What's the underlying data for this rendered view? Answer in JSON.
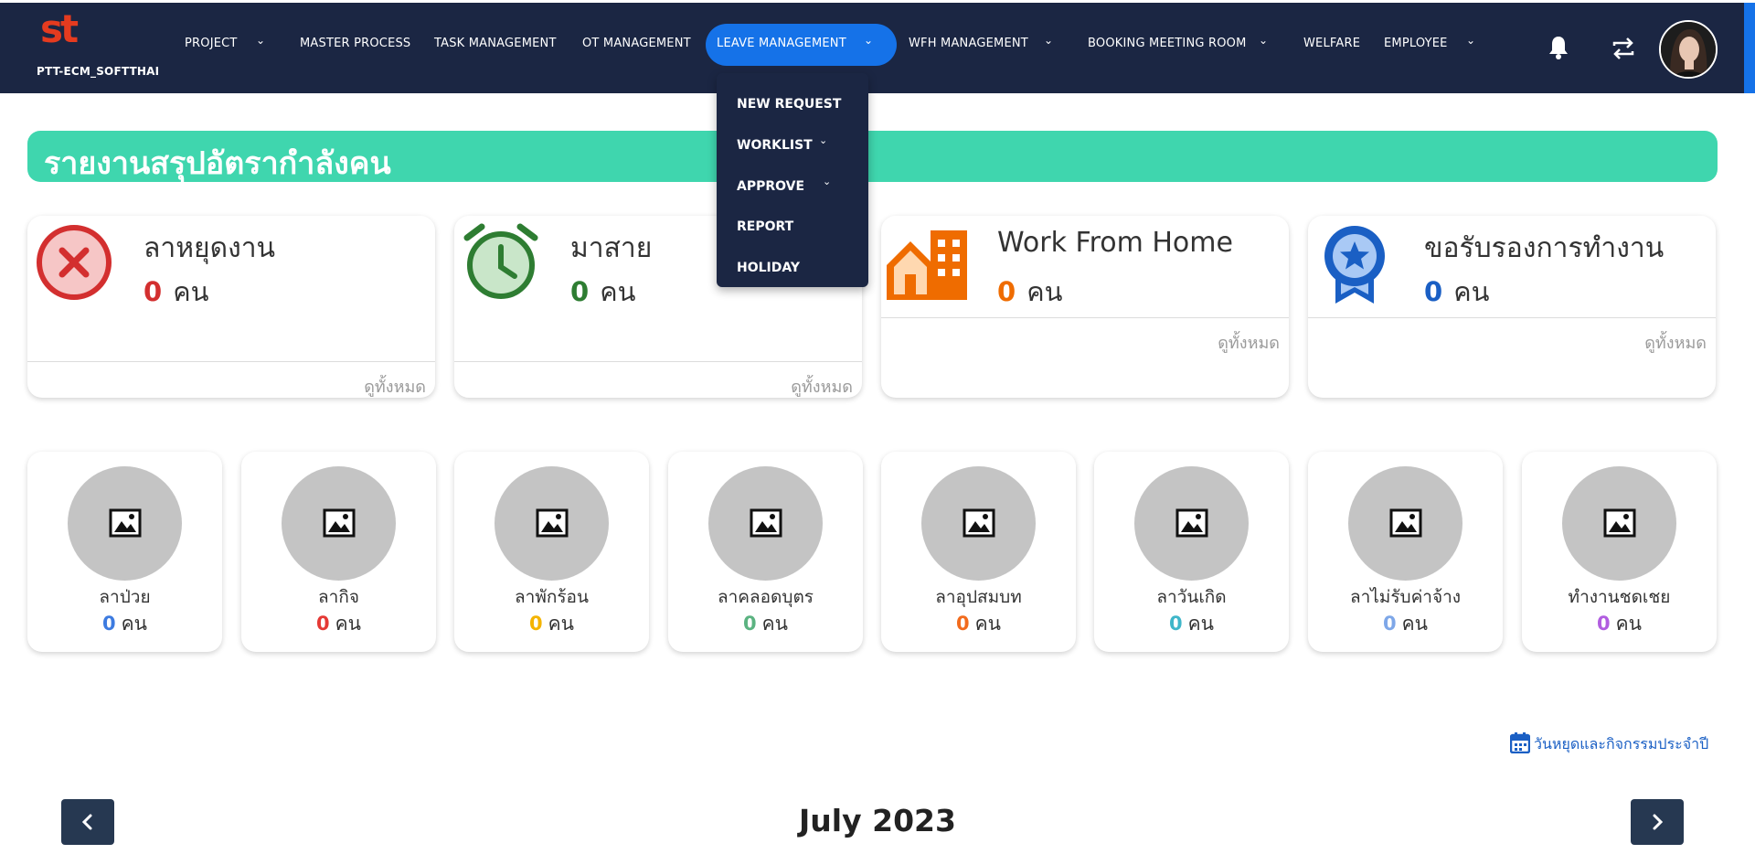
{
  "app": {
    "logo_text": "st",
    "org_name": "PTT-ECM_SOFTTHAI"
  },
  "nav": [
    {
      "label": "PROJECT",
      "dropdown": true
    },
    {
      "label": "MASTER PROCESS",
      "dropdown": false
    },
    {
      "label": "TASK MANAGEMENT",
      "dropdown": false
    },
    {
      "label": "OT MANAGEMENT",
      "dropdown": false
    },
    {
      "label": "LEAVE MANAGEMENT",
      "dropdown": true,
      "active": true
    },
    {
      "label": "WFH MANAGEMENT",
      "dropdown": true
    },
    {
      "label": "BOOKING MEETING ROOM",
      "dropdown": true
    },
    {
      "label": "WELFARE",
      "dropdown": false
    },
    {
      "label": "EMPLOYEE",
      "dropdown": true
    }
  ],
  "top_icons": [
    "bell-icon",
    "swap-icon"
  ],
  "dropdown": [
    {
      "label": "NEW REQUEST",
      "has_submenu": false
    },
    {
      "label": "WORKLIST",
      "has_submenu": true
    },
    {
      "label": "APPROVE",
      "has_submenu": true
    },
    {
      "label": "REPORT",
      "has_submenu": false
    },
    {
      "label": "HOLIDAY",
      "has_submenu": false
    }
  ],
  "banner": {
    "title": "รายงานสรุปอัตรากำลังคน",
    "color": "#3fd6ae"
  },
  "summary_cards": [
    {
      "label": "ลาหยุดงาน",
      "count": "0",
      "unit": "คน",
      "link": "ดูทั้งหมด",
      "icon": "x-circle-icon",
      "color": "#d32f2f"
    },
    {
      "label": "มาสาย",
      "count": "0",
      "unit": "คน",
      "link": "ดูทั้งหมด",
      "icon": "alarm-clock-icon",
      "color": "#2e7d32"
    },
    {
      "label": "Work From Home",
      "count": "0",
      "unit": "คน",
      "link": "ดูทั้งหมด",
      "icon": "building-icon",
      "color": "#ef6c00"
    },
    {
      "label": "ขอรับรองการทำงาน",
      "count": "0",
      "unit": "คน",
      "link": "ดูทั้งหมด",
      "icon": "award-ribbon-icon",
      "color": "#1a5fc4"
    }
  ],
  "leave_types": [
    {
      "label": "ลาป่วย",
      "count": "0",
      "unit": "คน",
      "color": "#3d7be0"
    },
    {
      "label": "ลากิจ",
      "count": "0",
      "unit": "คน",
      "color": "#e53935"
    },
    {
      "label": "ลาพักร้อน",
      "count": "0",
      "unit": "คน",
      "color": "#f4b400"
    },
    {
      "label": "ลาคลอดบุตร",
      "count": "0",
      "unit": "คน",
      "color": "#5bb381"
    },
    {
      "label": "ลาอุปสมบท",
      "count": "0",
      "unit": "คน",
      "color": "#f26b1d"
    },
    {
      "label": "ลาวันเกิด",
      "count": "0",
      "unit": "คน",
      "color": "#3fb6c9"
    },
    {
      "label": "ลาไม่รับค่าจ้าง",
      "count": "0",
      "unit": "คน",
      "color": "#7ea7e8"
    },
    {
      "label": "ทำงานชดเชย",
      "count": "0",
      "unit": "คน",
      "color": "#b15de0"
    }
  ],
  "holiday_link": {
    "label": "วันหยุดและกิจกรรมประจำปี",
    "icon": "calendar-icon"
  },
  "calendar": {
    "title": "July 2023",
    "prev_icon": "chevron-left-icon",
    "next_icon": "chevron-right-icon"
  }
}
